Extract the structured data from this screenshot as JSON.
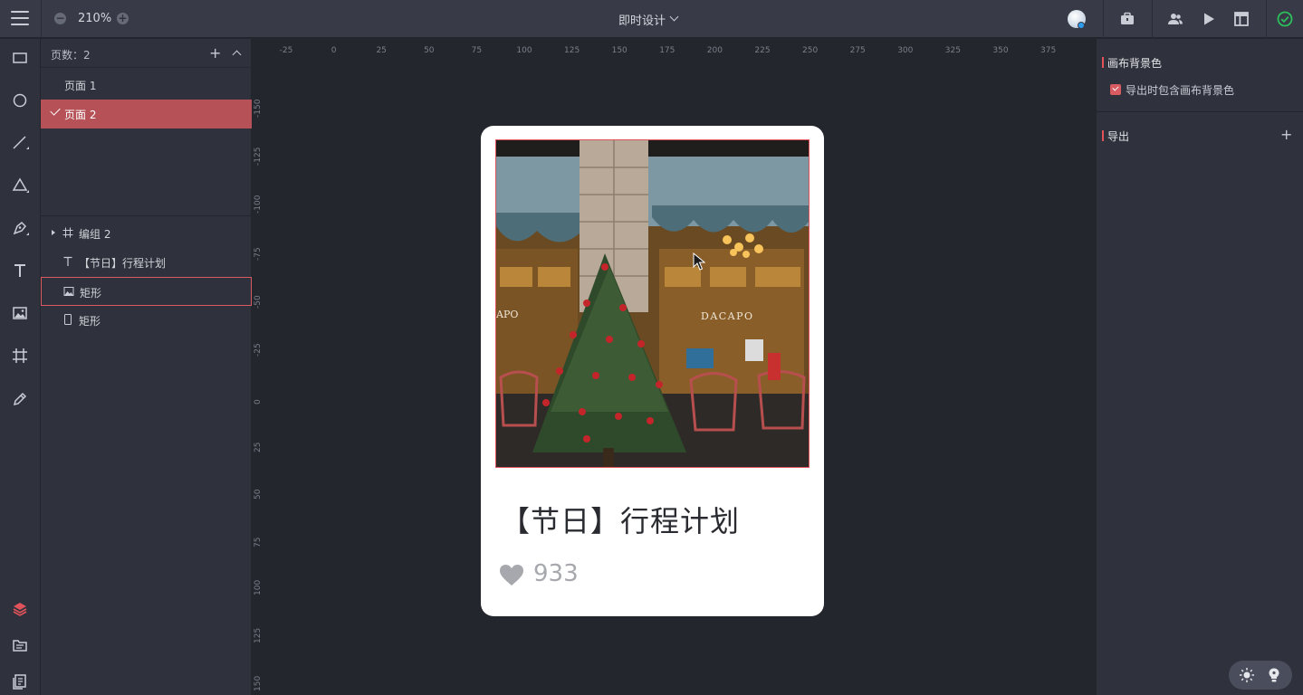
{
  "topbar": {
    "zoom_level": "210%",
    "doc_title": "即时设计"
  },
  "pages": {
    "count_label": "页数：2",
    "items": [
      {
        "label": "页面 1",
        "active": false
      },
      {
        "label": "页面 2",
        "active": true
      }
    ]
  },
  "layers": [
    {
      "label": "编组 2",
      "icon": "frame-icon"
    },
    {
      "label": "【节日】行程计划",
      "icon": "text-icon"
    },
    {
      "label": "矩形",
      "icon": "image-icon"
    },
    {
      "label": "矩形",
      "icon": "rectangle-icon"
    }
  ],
  "rulers": {
    "top": [
      "-25",
      "0",
      "25",
      "50",
      "75",
      "100",
      "125",
      "150",
      "175",
      "200",
      "225",
      "250",
      "275",
      "300",
      "325",
      "350",
      "375"
    ],
    "left": [
      "-150",
      "-125",
      "-100",
      "-75",
      "-50",
      "-25",
      "0",
      "25",
      "50",
      "75",
      "100",
      "125",
      "150"
    ]
  },
  "card": {
    "title": "【节日】行程计划",
    "likes": "933",
    "sign_left": "APO",
    "sign_right": "DACAPO"
  },
  "right_panel": {
    "bg_section": "画布背景色",
    "bg_checkbox_label": "导出时包含画布背景色",
    "export_section": "导出"
  },
  "colors": {
    "accent": "#e1535b",
    "active_page": "#b55157",
    "success": "#2bbf5a"
  }
}
